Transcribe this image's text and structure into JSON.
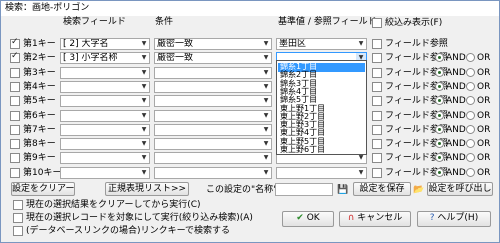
{
  "window": {
    "title": "検索：画地-ポリゴン"
  },
  "headers": {
    "field": "検索フィールド",
    "condition": "条件",
    "value": "基準値 / 参照フィールド"
  },
  "narrow_display": {
    "label": "絞込み表示(F)",
    "checked": false
  },
  "field_ref_label": "フィールド参照",
  "and_label": "AND",
  "or_label": "OR",
  "rows": [
    {
      "key": "第1キー",
      "checked": true,
      "field": "[ 2] 大字名",
      "condition": "厳密一致",
      "value": "墨田区",
      "field_ref": false,
      "has_logic": false
    },
    {
      "key": "第2キー",
      "checked": true,
      "field": "[ 3] 小字名称",
      "condition": "厳密一致",
      "value": "",
      "field_ref": false,
      "has_logic": true,
      "and": true
    },
    {
      "key": "第3キー",
      "checked": false,
      "field": "",
      "condition": "",
      "value": "",
      "field_ref": false,
      "has_logic": true,
      "and": true
    },
    {
      "key": "第4キー",
      "checked": false,
      "field": "",
      "condition": "",
      "value": "",
      "field_ref": false,
      "has_logic": true,
      "and": true
    },
    {
      "key": "第5キー",
      "checked": false,
      "field": "",
      "condition": "",
      "value": "",
      "field_ref": false,
      "has_logic": true,
      "and": true
    },
    {
      "key": "第6キー",
      "checked": false,
      "field": "",
      "condition": "",
      "value": "",
      "field_ref": false,
      "has_logic": true,
      "and": true
    },
    {
      "key": "第7キー",
      "checked": false,
      "field": "",
      "condition": "",
      "value": "",
      "field_ref": false,
      "has_logic": true,
      "and": true
    },
    {
      "key": "第8キー",
      "checked": false,
      "field": "",
      "condition": "",
      "value": "",
      "field_ref": false,
      "has_logic": true,
      "and": true
    },
    {
      "key": "第9キー",
      "checked": false,
      "field": "",
      "condition": "",
      "value": "",
      "field_ref": false,
      "has_logic": true,
      "and": true
    },
    {
      "key": "第10キー",
      "checked": false,
      "field": "",
      "condition": "",
      "value": "",
      "field_ref": false,
      "has_logic": true,
      "and": true
    }
  ],
  "dropdown_items": [
    {
      "label": "錦糸1丁目",
      "selected": true
    },
    {
      "label": "錦糸2丁目",
      "selected": false
    },
    {
      "label": "錦糸3丁目",
      "selected": false
    },
    {
      "label": "錦糸4丁目",
      "selected": false
    },
    {
      "label": "錦糸5丁目",
      "selected": false
    },
    {
      "label": "東上野1丁目",
      "selected": false
    },
    {
      "label": "東上野2丁目",
      "selected": false
    },
    {
      "label": "東上野3丁目",
      "selected": false
    },
    {
      "label": "東上野4丁目",
      "selected": false
    },
    {
      "label": "東上野5丁目",
      "selected": false
    },
    {
      "label": "東上野6丁目",
      "selected": false
    }
  ],
  "buttons": {
    "clear": "設定をクリアー",
    "regex": "正規表現リスト>>",
    "name_label": "この設定の\"名称\"",
    "save": "設定を保存",
    "load": "設定を呼び出し",
    "ok": "OK",
    "cancel": "キャンセル",
    "help": "ヘルプ(H)"
  },
  "options": [
    {
      "label": "現在の選択結果をクリアーしてから実行(C)",
      "checked": false
    },
    {
      "label": "現在の選択レコードを対象にして実行(絞り込み検索)(A)",
      "checked": false
    },
    {
      "label": "(データベースリンクの場合)リンクキーで検索する",
      "checked": false
    }
  ],
  "colors": {
    "accent": "#3399ff",
    "cancel_icon": "#cc2222",
    "help_icon": "#2a5cb0"
  }
}
